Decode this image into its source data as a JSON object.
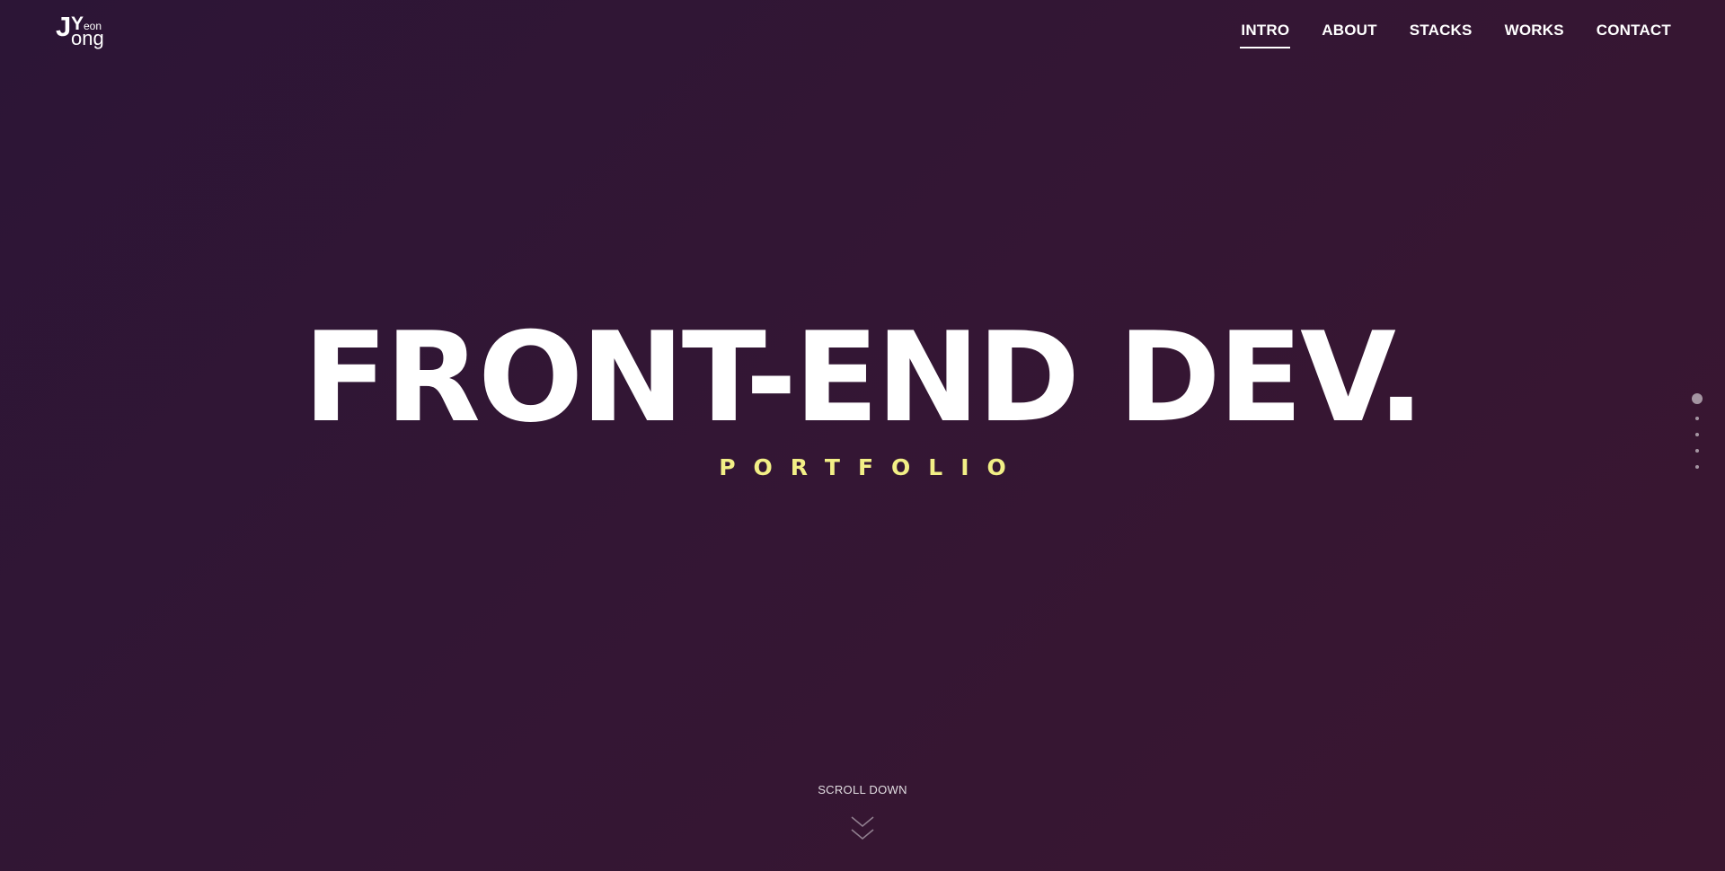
{
  "logo": {
    "j": "J",
    "y": "Y",
    "eon": "eon",
    "ong": "ong"
  },
  "nav": {
    "items": [
      {
        "label": "INTRO",
        "active": true
      },
      {
        "label": "ABOUT",
        "active": false
      },
      {
        "label": "STACKS",
        "active": false
      },
      {
        "label": "WORKS",
        "active": false
      },
      {
        "label": "CONTACT",
        "active": false
      }
    ]
  },
  "hero": {
    "title": "FRONT-END DEV.",
    "subtitle": "PORTFOLIO"
  },
  "pagination": {
    "count": 5,
    "active_index": 0
  },
  "scroll": {
    "label": "SCROLL DOWN",
    "icon": "double-chevron-down-icon"
  },
  "colors": {
    "background_start": "#2c1536",
    "background_end": "#3a1630",
    "accent_yellow": "#f2ef86",
    "text": "#ffffff"
  }
}
